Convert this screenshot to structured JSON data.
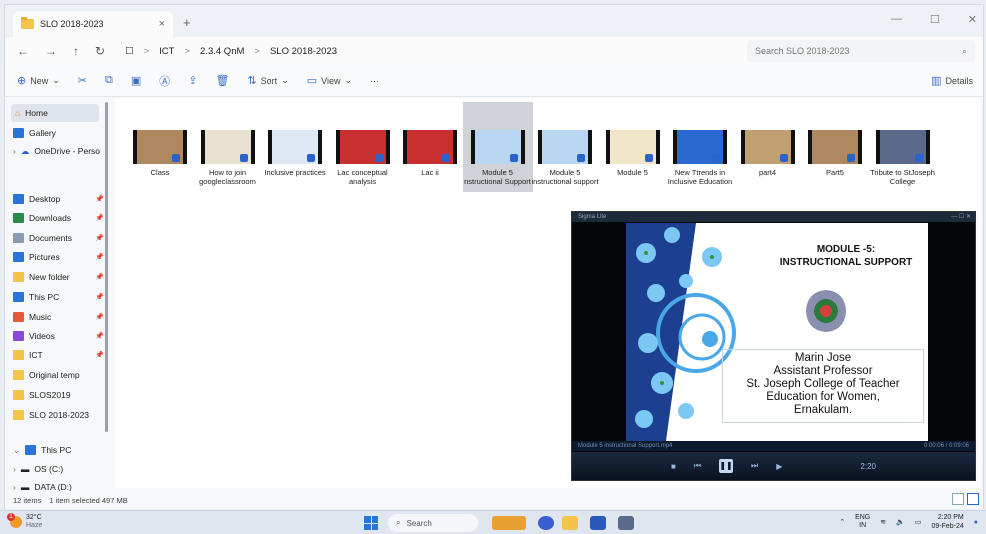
{
  "window": {
    "tab_title": "SLO 2018-2023",
    "tab_close": "×",
    "new_tab": "+",
    "controls": {
      "minimize": "—",
      "maximize": "☐",
      "close": "✕"
    }
  },
  "address": {
    "back": "←",
    "forward": "→",
    "up": "↑",
    "refresh": "↻",
    "monitor_icon": "☐",
    "crumbs": [
      "ICT",
      "2.3.4 QnM",
      "SLO 2018-2023"
    ],
    "separator": ">",
    "search_placeholder": "Search SLO 2018-2023",
    "search_icon": "⌕"
  },
  "commands": {
    "new": "New",
    "sort": "Sort",
    "view": "View",
    "more": "···",
    "details": "Details",
    "icons": {
      "cut": "✂",
      "copy": "⧉",
      "paste": "▣",
      "rename": "Ⓐ",
      "share": "⇪",
      "delete": "🗑"
    }
  },
  "nav": {
    "home": "Home",
    "gallery": "Gallery",
    "onedrive": "OneDrive - Perso",
    "quick": [
      {
        "label": "Desktop",
        "color": "#2a73d9"
      },
      {
        "label": "Downloads",
        "color": "#2a8a4a"
      },
      {
        "label": "Documents",
        "color": "#8a9ab0"
      },
      {
        "label": "Pictures",
        "color": "#2a73d9"
      },
      {
        "label": "New folder",
        "color": "#f4c54a"
      },
      {
        "label": "This PC",
        "color": "#2a73d9"
      },
      {
        "label": "Music",
        "color": "#e55a3a"
      },
      {
        "label": "Videos",
        "color": "#8a4ad9"
      },
      {
        "label": "ICT",
        "color": "#f4c54a"
      },
      {
        "label": "Original temp",
        "color": "#f4c54a"
      },
      {
        "label": "SLOS2019",
        "color": "#f4c54a"
      },
      {
        "label": "SLO 2018-2023",
        "color": "#f4c54a"
      }
    ],
    "this_pc": "This PC",
    "drives": [
      "OS (C:)",
      "DATA (D:)"
    ]
  },
  "files": [
    {
      "label": "Class",
      "thumb": "#b08860"
    },
    {
      "label": "How to join googleclassroom",
      "thumb": "#e8e0d0"
    },
    {
      "label": "Inclusive practices",
      "thumb": "#dfe9f5"
    },
    {
      "label": "Lac conceptual analysis",
      "thumb": "#c83030"
    },
    {
      "label": "Lac ii",
      "thumb": "#c83030"
    },
    {
      "label": "Module 5 nstructional Support",
      "thumb": "#b9d6f2"
    },
    {
      "label": "Module 5 instructional support",
      "thumb": "#b9d6f2"
    },
    {
      "label": "Module 5",
      "thumb": "#f2e6c8"
    },
    {
      "label": "New Ttrends in Inclusive Education",
      "thumb": "#2a6ad0"
    },
    {
      "label": "part4",
      "thumb": "#c0a070"
    },
    {
      "label": "Part5",
      "thumb": "#b08860"
    },
    {
      "label": "Tribute to StJoseph College",
      "thumb": "#5a6a8a"
    }
  ],
  "selected_index": 5,
  "player": {
    "title": "Sigma Lite",
    "slide_heading_1": "MODULE -5:",
    "slide_heading_2": "INSTRUCTIONAL SUPPORT",
    "author_lines": [
      "Marin Jose",
      "Assistant Professor",
      "St. Joseph College of Teacher",
      "Education for Women,",
      "Ernakulam."
    ],
    "filename": "Module 5 instructional Support.mp4",
    "time": "0:00:06 / 0:09:06",
    "volume": "2:20"
  },
  "status": {
    "items": "12 items",
    "selected": "1 item selected  497 MB"
  },
  "taskbar": {
    "temp": "32°C",
    "weather": "Haze",
    "search": "Search",
    "lang_1": "ENG",
    "lang_2": "IN",
    "time": "2:20 PM",
    "date": "09-Feb-24"
  }
}
